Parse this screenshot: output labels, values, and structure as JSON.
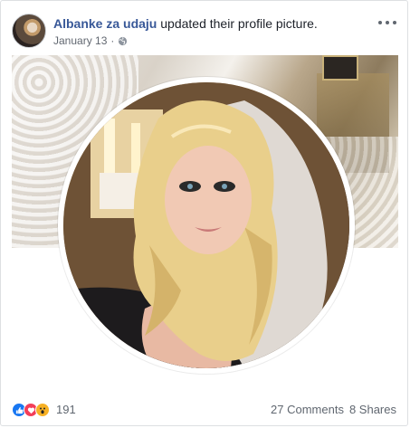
{
  "post": {
    "author": "Albanke za udaju",
    "action": "updated their profile picture.",
    "date": "January 13",
    "date_separator": "·",
    "privacy_icon": "globe-icon",
    "more_icon": "more-options-icon"
  },
  "reactions": {
    "types": [
      "like",
      "love",
      "wow"
    ],
    "count": "191"
  },
  "engagement": {
    "comments": "27 Comments",
    "shares": "8 Shares"
  },
  "colors": {
    "author_link": "#385898",
    "like": "#1877f2",
    "love": "#f33e58",
    "wow": "#f7b125"
  }
}
